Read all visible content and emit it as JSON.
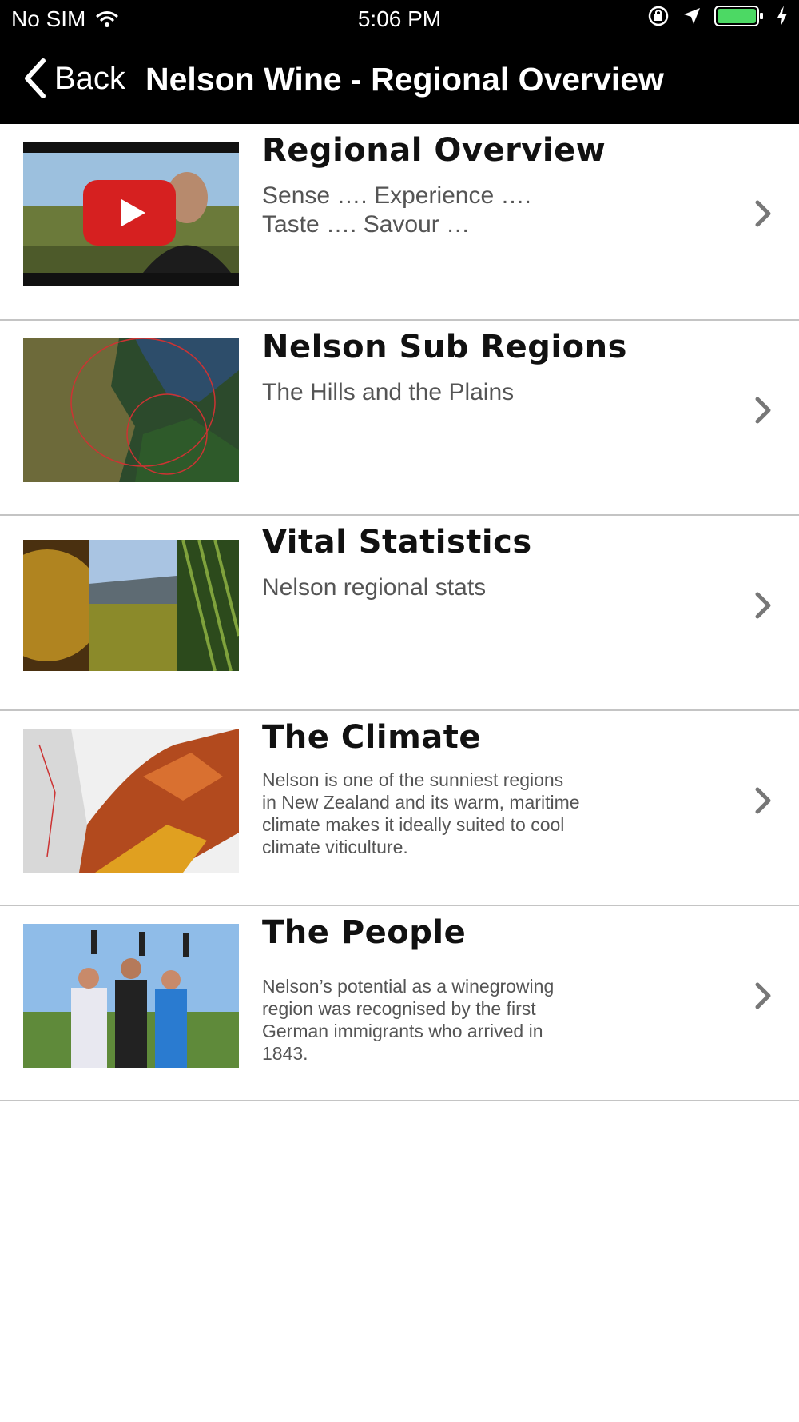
{
  "status_bar": {
    "carrier": "No SIM",
    "time": "5:06 PM",
    "battery_color": "#4cd964"
  },
  "nav": {
    "back_label": "Back",
    "title": "Nelson Wine - Regional Overview"
  },
  "items": [
    {
      "title": "Regional Overview",
      "description": "Sense …. Experience …. Taste …. Savour …",
      "thumb": "video-thumbnail"
    },
    {
      "title": "Nelson Sub Regions",
      "description": "The Hills and the Plains",
      "thumb": "satellite-map"
    },
    {
      "title": "Vital Statistics",
      "description": "Nelson regional stats",
      "thumb": "vineyard-collage"
    },
    {
      "title": "The Climate",
      "description": "Nelson is one of the sunniest regions in New Zealand and its warm, maritime climate makes it ideally suited to cool climate viticulture.",
      "thumb": "climate-map"
    },
    {
      "title": "The People",
      "description": "Nelson’s potential as a winegrowing region was recognised by the first German immigrants who arrived in 1843.",
      "thumb": "people-photo"
    }
  ]
}
